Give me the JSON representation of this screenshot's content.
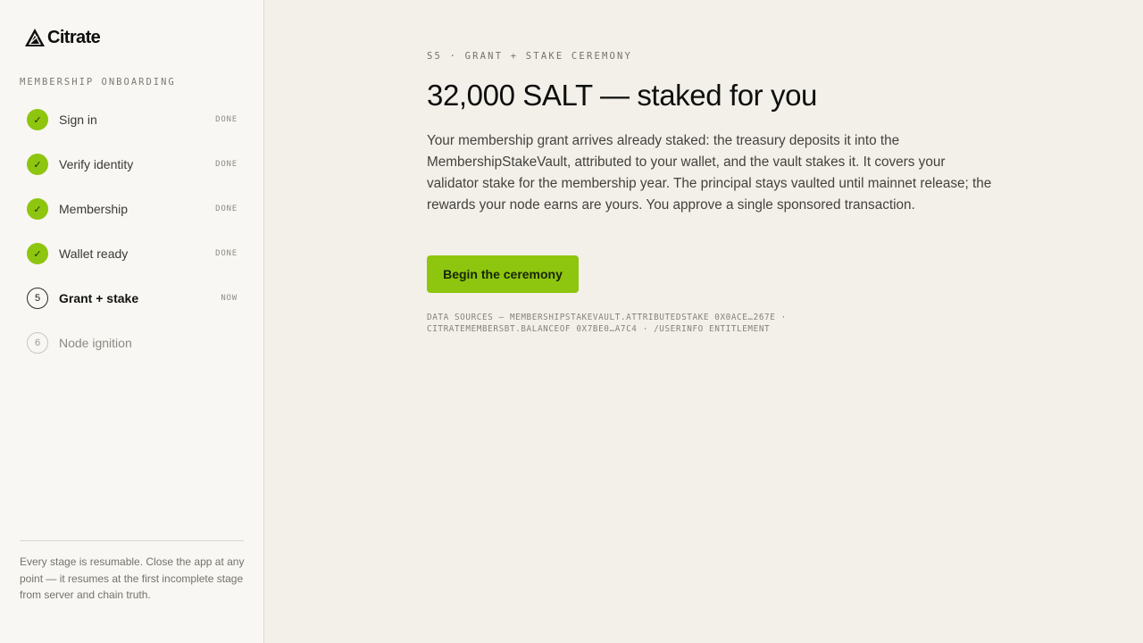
{
  "brand": {
    "name": "Citrate",
    "logo_icon": "triangle-mark-icon"
  },
  "sidebar": {
    "section_label": "MEMBERSHIP ONBOARDING",
    "steps": [
      {
        "marker": "✓",
        "label": "Sign in",
        "status": "DONE",
        "state": "done"
      },
      {
        "marker": "✓",
        "label": "Verify identity",
        "status": "DONE",
        "state": "done"
      },
      {
        "marker": "✓",
        "label": "Membership",
        "status": "DONE",
        "state": "done"
      },
      {
        "marker": "✓",
        "label": "Wallet ready",
        "status": "DONE",
        "state": "done"
      },
      {
        "marker": "5",
        "label": "Grant + stake",
        "status": "NOW",
        "state": "current"
      },
      {
        "marker": "6",
        "label": "Node ignition",
        "status": "",
        "state": "pending"
      }
    ],
    "note": "Every stage is resumable. Close the app at any point — it resumes at the first incomplete stage from server and chain truth."
  },
  "main": {
    "eyebrow": "S5 · GRANT + STAKE CEREMONY",
    "headline": "32,000 SALT — staked for you",
    "body": "Your membership grant arrives already staked: the treasury deposits it into the MembershipStakeVault, attributed to your wallet, and the vault stakes it. It covers your validator stake for the membership year. The principal stays vaulted until mainnet release; the rewards your node earns are yours. You approve a single sponsored transaction.",
    "cta_label": "Begin the ceremony",
    "data_sources": "Data sources — MembershipStakeVault.attributedStake 0x0ACE…267E · CitrateMemberSBT.balanceOf 0x7BE0…A7C4 · /userinfo entitlement"
  },
  "colors": {
    "accent": "#8ec50f",
    "background": "#f3f0ea",
    "sidebar_background": "#f8f7f3",
    "text": "#1b1b18"
  }
}
